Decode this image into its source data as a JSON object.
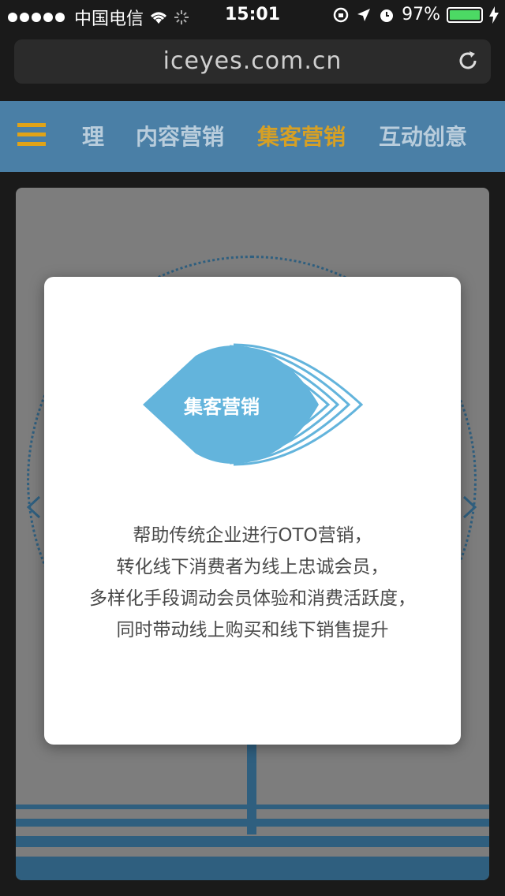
{
  "status_bar": {
    "carrier": "中国电信",
    "time": "15:01",
    "battery": "97%"
  },
  "url_bar": {
    "url": "iceyes.com.cn"
  },
  "nav": {
    "items": [
      {
        "label": "理",
        "active": false
      },
      {
        "label": "内容营销",
        "active": false
      },
      {
        "label": "集客营销",
        "active": true
      },
      {
        "label": "互动创意",
        "active": false
      }
    ],
    "accent_color": "#d6a025",
    "background_color": "#4a7fa6"
  },
  "modal": {
    "emblem_label": "集客营销",
    "emblem_color": "#63b4dc",
    "description": [
      "帮助传统企业进行OTO营销，",
      "转化线下消费者为线上忠诚会员，",
      "多样化手段调动会员体验和消费活跃度，",
      "同时带动线上购买和线下销售提升"
    ]
  }
}
